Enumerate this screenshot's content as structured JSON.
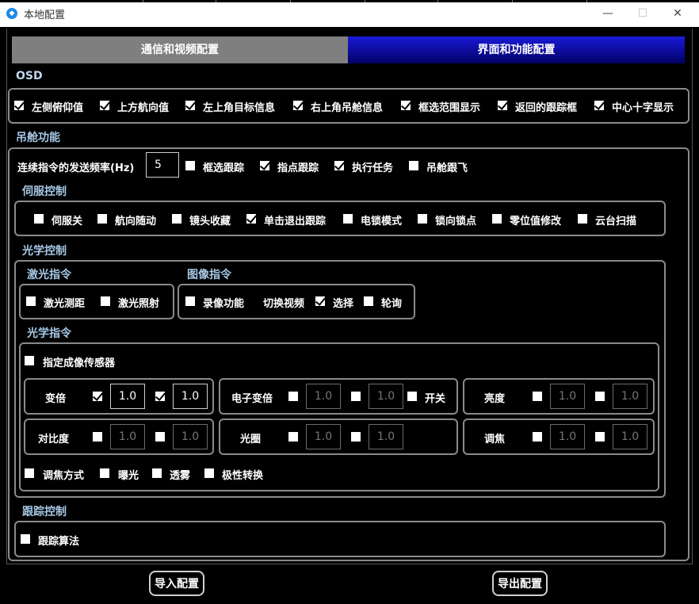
{
  "window": {
    "title": "本地配置",
    "min": "—",
    "max": "☐",
    "close": "✕"
  },
  "tabs": [
    "通信和视频配置",
    "界面和功能配置"
  ],
  "osd": {
    "title": "OSD",
    "items": [
      {
        "label": "左侧俯仰值",
        "checked": true
      },
      {
        "label": "上方航向值",
        "checked": true
      },
      {
        "label": "左上角目标信息",
        "checked": true
      },
      {
        "label": "右上角吊舱信息",
        "checked": true
      },
      {
        "label": "框选范围显示",
        "checked": true
      },
      {
        "label": "返回的跟踪框",
        "checked": true
      },
      {
        "label": "中心十字显示",
        "checked": true
      }
    ]
  },
  "pod": {
    "title": "吊舱功能",
    "freq_label": "连续指令的发送频率(Hz)",
    "freq_value": "5",
    "items": [
      {
        "label": "框选跟踪",
        "checked": false
      },
      {
        "label": "指点跟踪",
        "checked": true
      },
      {
        "label": "执行任务",
        "checked": true
      },
      {
        "label": "吊舱跟飞",
        "checked": false
      }
    ]
  },
  "servo": {
    "title": "伺服控制",
    "items": [
      {
        "label": "伺服关",
        "checked": false
      },
      {
        "label": "航向随动",
        "checked": false
      },
      {
        "label": "镜头收藏",
        "checked": false
      },
      {
        "label": "单击退出跟踪",
        "checked": true
      },
      {
        "label": "电锁模式",
        "checked": false
      },
      {
        "label": "锁向锁点",
        "checked": false
      },
      {
        "label": "零位值修改",
        "checked": false
      },
      {
        "label": "云台扫描",
        "checked": false
      }
    ]
  },
  "optics": {
    "title": "光学控制",
    "laser": {
      "title": "激光指令",
      "items": [
        {
          "label": "激光测距",
          "checked": false
        },
        {
          "label": "激光照射",
          "checked": false
        }
      ]
    },
    "image": {
      "title": "图像指令",
      "record": "录像功能",
      "switch": "切换视频",
      "select": "选择",
      "poll": "轮询",
      "select_checked": true
    },
    "optic": {
      "title": "光学指令",
      "sensor_label": "指定成像传感器",
      "zoom": {
        "label": "变倍",
        "v1": "1.0",
        "v2": "1.0"
      },
      "ezoom": {
        "label": "电子变倍",
        "v1": "1.0",
        "v2": "1.0",
        "switch": "开关"
      },
      "bright": {
        "label": "亮度",
        "v1": "1.0",
        "v2": "1.0"
      },
      "contrast": {
        "label": "对比度",
        "v1": "1.0",
        "v2": "1.0"
      },
      "iris": {
        "label": "光圈",
        "v1": "1.0",
        "v2": "1.0"
      },
      "focus": {
        "label": "调焦",
        "v1": "1.0",
        "v2": "1.0"
      },
      "bottom": [
        "调焦方式",
        "曝光",
        "透雾",
        "极性转换"
      ]
    }
  },
  "track": {
    "title": "跟踪控制",
    "algo": "跟踪算法"
  },
  "buttons": {
    "import": "导入配置",
    "export": "导出配置"
  }
}
